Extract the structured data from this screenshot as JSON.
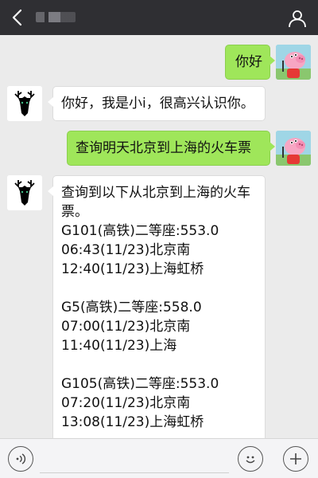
{
  "header": {
    "back_icon": "chevron-left-icon",
    "contact_name": "",
    "profile_icon": "person-icon"
  },
  "messages": [
    {
      "sender": "user",
      "lines": [
        "你好"
      ]
    },
    {
      "sender": "bot",
      "lines": [
        "你好，我是小i，很高兴认识你。"
      ]
    },
    {
      "sender": "user",
      "lines": [
        "查询明天北京到上海的火车票"
      ]
    },
    {
      "sender": "bot",
      "lines": [
        "查询到以下从北京到上海的火车",
        "票。",
        "G101(高铁)二等座:553.0",
        "06:43(11/23)北京南",
        "12:40(11/23)上海虹桥",
        "",
        "G5(高铁)二等座:558.0",
        "07:00(11/23)北京南",
        "11:40(11/23)上海",
        "",
        "G105(高铁)二等座:553.0",
        "07:20(11/23)北京南",
        "13:08(11/23)上海虹桥"
      ]
    }
  ],
  "bottom_bar": {
    "voice_icon": "voice-icon",
    "input_value": "",
    "emoji_icon": "smiley-icon",
    "more_icon": "plus-icon"
  },
  "colors": {
    "header_bg": "#2f2f33",
    "chat_bg": "#ebebeb",
    "user_bubble": "#9fe65a",
    "bot_bubble": "#ffffff"
  }
}
